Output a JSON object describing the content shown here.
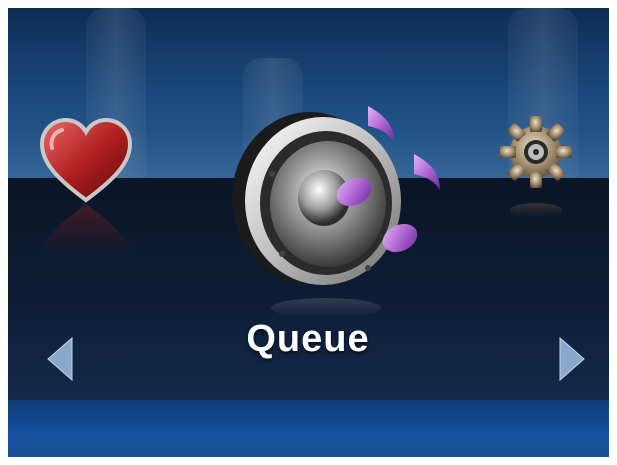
{
  "menu": {
    "current_label": "Queue",
    "items": [
      {
        "icon": "heart-icon"
      },
      {
        "icon": "speaker-music-icon"
      },
      {
        "icon": "gear-icon"
      }
    ],
    "nav": {
      "prev_icon": "left-arrow-icon",
      "next_icon": "right-arrow-icon"
    }
  },
  "colors": {
    "top_band": "#1d4b80",
    "stage": "#0d1d35",
    "bottom_band": "#1550a0",
    "label": "#ffffff",
    "heart": "#c62a2a",
    "music_note": "#b167d6"
  }
}
